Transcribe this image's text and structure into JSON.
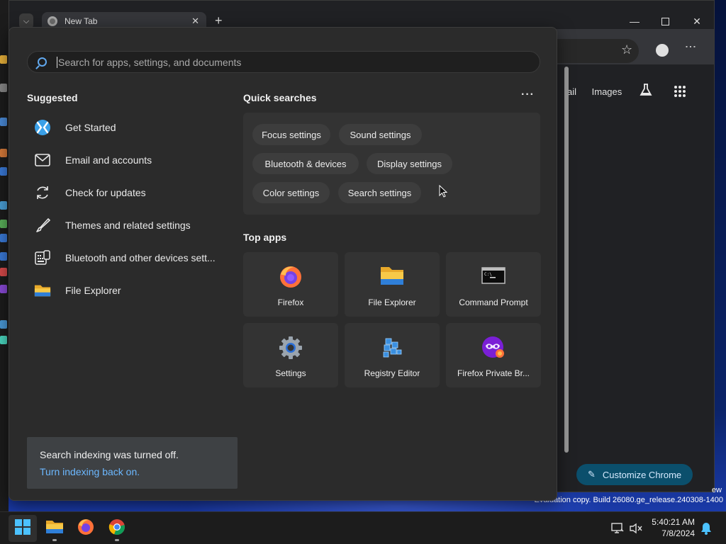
{
  "browser": {
    "tab_title": "New Tab",
    "ntp_links": [
      "ail",
      "Images"
    ],
    "customize_label": "Customize Chrome"
  },
  "watermark": {
    "edge_text": "ew",
    "build_text": "Evaluation copy. Build 26080.ge_release.240308-1400"
  },
  "search": {
    "placeholder": "Search for apps, settings, and documents"
  },
  "suggested": {
    "title": "Suggested",
    "items": [
      {
        "label": "Get Started",
        "icon": "get-started-icon"
      },
      {
        "label": "Email and accounts",
        "icon": "mail-icon"
      },
      {
        "label": "Check for updates",
        "icon": "refresh-icon"
      },
      {
        "label": "Themes and related settings",
        "icon": "brush-icon"
      },
      {
        "label": "Bluetooth and other devices sett...",
        "icon": "keyboard-devices-icon"
      },
      {
        "label": "File Explorer",
        "icon": "folder-icon"
      }
    ]
  },
  "quick_searches": {
    "title": "Quick searches",
    "chips": [
      "Focus settings",
      "Sound settings",
      "Bluetooth & devices",
      "Display settings",
      "Color settings",
      "Search settings"
    ]
  },
  "top_apps": {
    "title": "Top apps",
    "apps": [
      {
        "label": "Firefox",
        "icon": "firefox-icon"
      },
      {
        "label": "File Explorer",
        "icon": "folder-icon"
      },
      {
        "label": "Command Prompt",
        "icon": "terminal-icon"
      },
      {
        "label": "Settings",
        "icon": "gear-icon"
      },
      {
        "label": "Registry Editor",
        "icon": "registry-icon"
      },
      {
        "label": "Firefox Private Br...",
        "icon": "firefox-private-icon"
      }
    ]
  },
  "index_banner": {
    "message": "Search indexing was turned off.",
    "link": "Turn indexing back on."
  },
  "taskbar": {
    "time": "5:40:21 AM",
    "date": "7/8/2024"
  },
  "colors": {
    "accent": "#61a8ee",
    "link": "#6cb8ff",
    "flyout_bg": "#2b2b2b",
    "tile_bg": "#333333"
  }
}
